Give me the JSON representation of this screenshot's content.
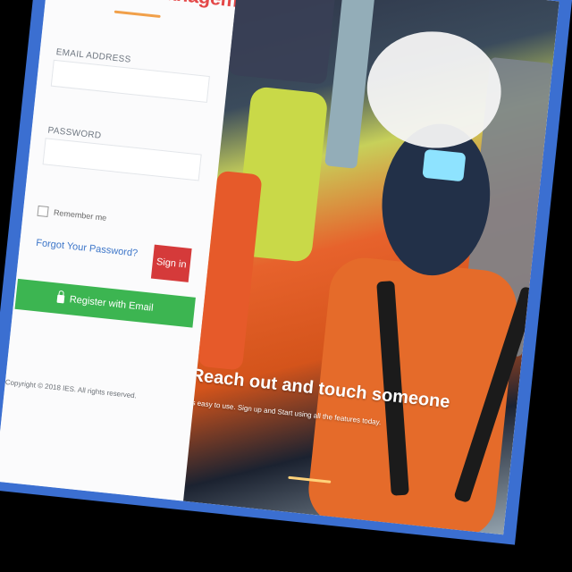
{
  "app": {
    "title": "IES CV Management"
  },
  "login": {
    "email_label": "EMAIL ADDRESS",
    "email_value": "",
    "email_placeholder": "",
    "password_label": "PASSWORD",
    "password_value": "",
    "password_placeholder": "",
    "remember_label": "Remember me",
    "forgot_label": "Forgot Your Password?",
    "signin_label": "Sign in",
    "register_label": "Register with Email"
  },
  "footer": {
    "copyright": "Copyright © 2018 IES. All rights reserved."
  },
  "hero": {
    "tagline": "Reach out and touch someone",
    "subtext": "It's easy to use. Sign up and Start using all the features today."
  },
  "colors": {
    "frame": "#3b6fd1",
    "title": "#e44848",
    "signin": "#d53a3a",
    "register": "#3cb551",
    "link": "#3d76c9"
  },
  "icons": {
    "register": "lock-icon"
  }
}
